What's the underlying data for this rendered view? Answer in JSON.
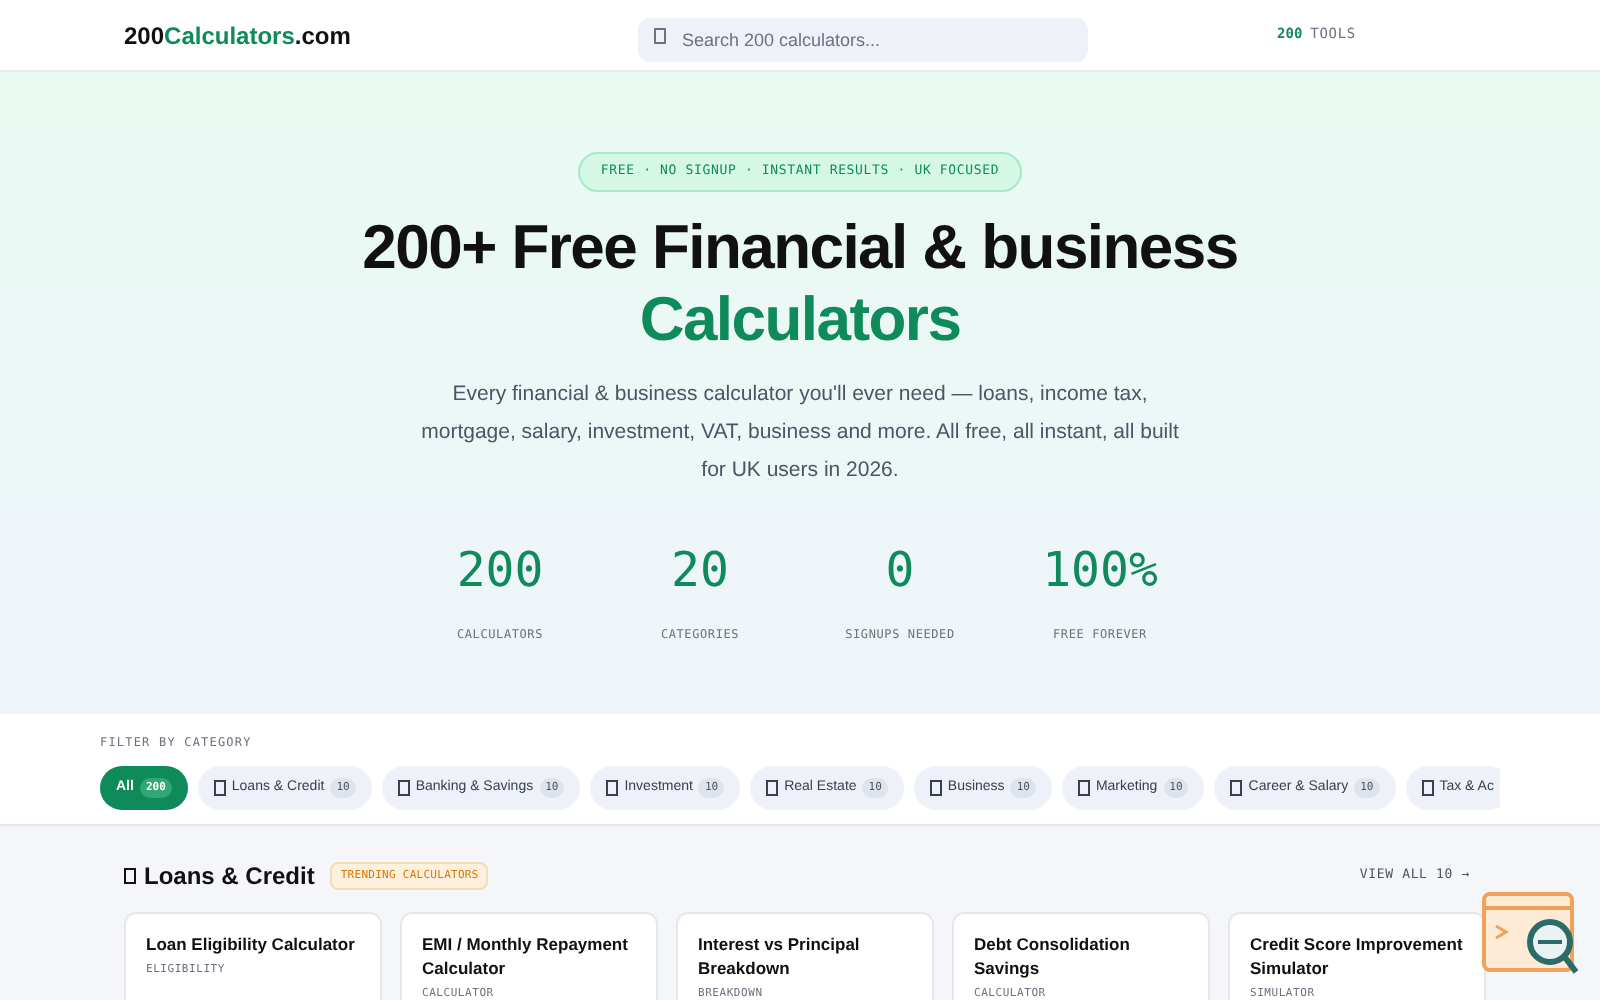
{
  "header": {
    "logo_prefix": "200",
    "logo_accent": "Calculators",
    "logo_suffix": ".com",
    "search": {
      "placeholder": "Search 200 calculators..."
    },
    "tools_count": "200",
    "tools_label": "TOOLS"
  },
  "hero": {
    "badge": "FREE · NO SIGNUP · INSTANT RESULTS · UK FOCUSED",
    "title": "200+ Free Financial & business",
    "title_accent": "Calculators",
    "subtitle": "Every financial & business calculator you'll ever need — loans, income tax, mortgage, salary, investment, VAT, business and more. All free, all instant, all built for UK users in 2026.",
    "stats": [
      {
        "value": "200",
        "label": "CALCULATORS"
      },
      {
        "value": "20",
        "label": "CATEGORIES"
      },
      {
        "value": "0",
        "label": "SIGNUPS NEEDED"
      },
      {
        "value": "100%",
        "label": "FREE FOREVER"
      }
    ]
  },
  "filter": {
    "label": "FILTER BY CATEGORY",
    "chips": [
      {
        "label": "All",
        "count": "200",
        "selected": true
      },
      {
        "label": "Loans & Credit",
        "count": "10",
        "selected": false
      },
      {
        "label": "Banking & Savings",
        "count": "10",
        "selected": false
      },
      {
        "label": "Investment",
        "count": "10",
        "selected": false
      },
      {
        "label": "Real Estate",
        "count": "10",
        "selected": false
      },
      {
        "label": "Business",
        "count": "10",
        "selected": false
      },
      {
        "label": "Marketing",
        "count": "10",
        "selected": false
      },
      {
        "label": "Career & Salary",
        "count": "10",
        "selected": false
      },
      {
        "label": "Tax & Ac",
        "selected": false
      }
    ]
  },
  "section": {
    "title": "Loans & Credit",
    "badge": "TRENDING CALCULATORS",
    "view_all": "VIEW ALL 10 →",
    "cards": [
      {
        "title": "Loan Eligibility Calculator",
        "tag": "ELIGIBILITY"
      },
      {
        "title": "EMI / Monthly Repayment Calculator",
        "tag": "CALCULATOR"
      },
      {
        "title": "Interest vs Principal Breakdown",
        "tag": "BREAKDOWN"
      },
      {
        "title": "Debt Consolidation Savings",
        "tag": "CALCULATOR"
      },
      {
        "title": "Credit Score Improvement Simulator",
        "tag": "SIMULATOR"
      }
    ]
  }
}
